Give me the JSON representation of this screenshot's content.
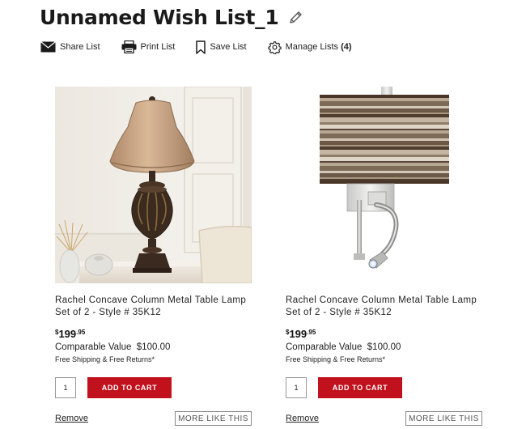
{
  "page": {
    "title": "Unnamed Wish List_1"
  },
  "actions": {
    "share_label": "Share List",
    "print_label": "Print List",
    "save_label": "Save List",
    "manage_label": "Manage Lists",
    "manage_count": "(4)"
  },
  "icons": {
    "edit": "pencil-icon",
    "share": "envelope-icon",
    "print": "printer-icon",
    "save": "bookmark-icon",
    "manage": "gear-icon"
  },
  "products": [
    {
      "name": "Rachel Concave Column Metal Table Lamp Set of 2 - Style # 35K12",
      "price_currency": "$",
      "price_whole": "199",
      "price_cents": ".95",
      "comparable_value": "Comparable Value  $100.00",
      "shipping": "Free Shipping & Free Returns*",
      "quantity": "1",
      "add_to_cart_label": "ADD TO CART",
      "remove_label": "Remove",
      "more_like_this_label": "MORE LIKE THIS"
    },
    {
      "name": "Rachel Concave Column Metal Table Lamp Set of 2 - Style # 35K12",
      "price_currency": "$",
      "price_whole": "199",
      "price_cents": ".95",
      "comparable_value": "Comparable Value  $100.00",
      "shipping": "Free Shipping & Free Returns*",
      "quantity": "1",
      "add_to_cart_label": "ADD TO CART",
      "remove_label": "Remove",
      "more_like_this_label": "MORE LIKE THIS"
    }
  ],
  "colors": {
    "add_to_cart_bg": "#c0111c",
    "text": "#222222"
  }
}
